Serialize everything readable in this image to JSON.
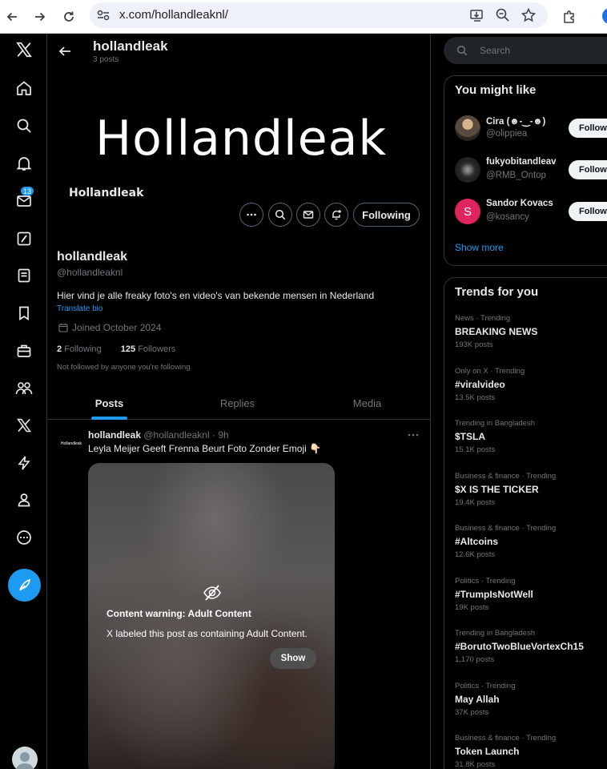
{
  "browser": {
    "url": "x.com/hollandleaknl/"
  },
  "nav": {
    "notifications_badge": "13"
  },
  "topbar": {
    "name": "hollandleak",
    "posts_count": "3 posts"
  },
  "banner": {
    "wordmark": "Hollandleak",
    "avatar_text": "Hollandleak"
  },
  "profile": {
    "follow_state": "Following",
    "name": "hollandleak",
    "handle": "@hollandleaknl",
    "bio": "Hier vind je alle freaky foto's en video's van bekende mensen in Nederland",
    "translate": "Translate bio",
    "joined": "Joined October 2024",
    "following_count": "2",
    "following_label": "Following",
    "followers_count": "125",
    "followers_label": "Followers",
    "not_followed": "Not followed by anyone you're following"
  },
  "tabs": [
    {
      "label": "Posts",
      "active": true
    },
    {
      "label": "Replies",
      "active": false
    },
    {
      "label": "Media",
      "active": false
    }
  ],
  "post": {
    "avatar_text": "Hollandleak",
    "name": "hollandleak",
    "handle": "@hollandleaknl",
    "time": "9h",
    "text": "Leyla Meijer Geeft Frenna Beurt Foto Zonder Emoji 👇🏻",
    "warning_title": "Content warning: Adult Content",
    "warning_desc": "X labeled this post as containing Adult Content.",
    "show_label": "Show"
  },
  "search": {
    "placeholder": "Search"
  },
  "you_might_like": {
    "title": "You might like",
    "users": [
      {
        "name": "Cira (☻-‿-☻)",
        "handle": "@olippiea",
        "button": "Follow"
      },
      {
        "name": "fukyobitandleav",
        "handle": "@RMB_Ontop",
        "button": "Follow"
      },
      {
        "name": "Sandor Kovacs",
        "handle": "@kosancy",
        "button": "Follow"
      }
    ],
    "show_more": "Show more"
  },
  "trends": {
    "title": "Trends for you",
    "items": [
      {
        "context": "News · Trending",
        "topic": "BREAKING NEWS",
        "count": "193K posts"
      },
      {
        "context": "Only on X · Trending",
        "topic": "#viralvideo",
        "count": "13.5K posts"
      },
      {
        "context": "Trending in Bangladesh",
        "topic": "$TSLA",
        "count": "15.1K posts"
      },
      {
        "context": "Business & finance · Trending",
        "topic": "$X IS THE TICKER",
        "count": "19.4K posts"
      },
      {
        "context": "Business & finance · Trending",
        "topic": "#Altcoins",
        "count": "12.6K posts"
      },
      {
        "context": "Politics · Trending",
        "topic": "#TrumpIsNotWell",
        "count": "19K posts"
      },
      {
        "context": "Trending in Bangladesh",
        "topic": "#BorutoTwoBlueVortexCh15",
        "count": "1,170 posts"
      },
      {
        "context": "Politics · Trending",
        "topic": "May Allah",
        "count": "37K posts"
      },
      {
        "context": "Business & finance · Trending",
        "topic": "Token Launch",
        "count": "31.8K posts"
      }
    ]
  }
}
